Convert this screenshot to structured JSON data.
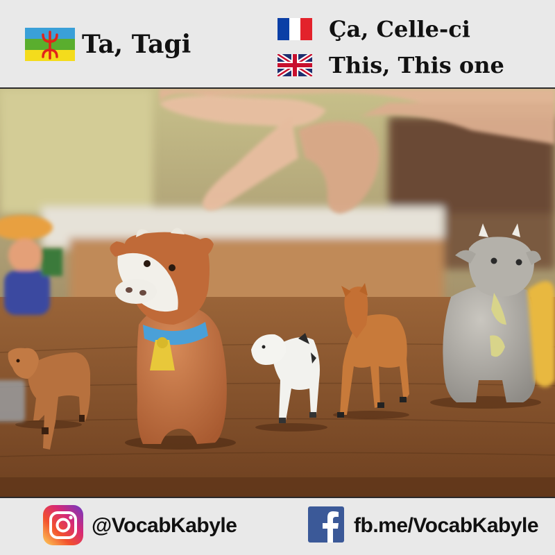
{
  "header": {
    "kabyle": {
      "flag_icon": "amazigh-flag-icon",
      "word": "Ta, Tagi"
    },
    "french": {
      "flag_icon": "france-flag-icon",
      "word": "Ça, Celle-ci"
    },
    "english": {
      "flag_icon": "uk-flag-icon",
      "word": "This, This one"
    }
  },
  "photo": {
    "subject": "child-hand-pointing-at-toy-animals-icon"
  },
  "footer": {
    "instagram": {
      "icon": "instagram-icon",
      "handle": "@VocabKabyle"
    },
    "facebook": {
      "icon": "facebook-icon",
      "handle": "fb.me/VocabKabyle"
    }
  },
  "colors": {
    "amazigh_blue": "#3aa0d8",
    "amazigh_green": "#5aae2e",
    "amazigh_yellow": "#f4dc1c",
    "amazigh_red": "#e2231a",
    "france_blue": "#0b3fa6",
    "france_red": "#e3222b",
    "uk_blue": "#1d2f6f",
    "uk_red": "#c8102e",
    "facebook_blue": "#3b5998"
  }
}
